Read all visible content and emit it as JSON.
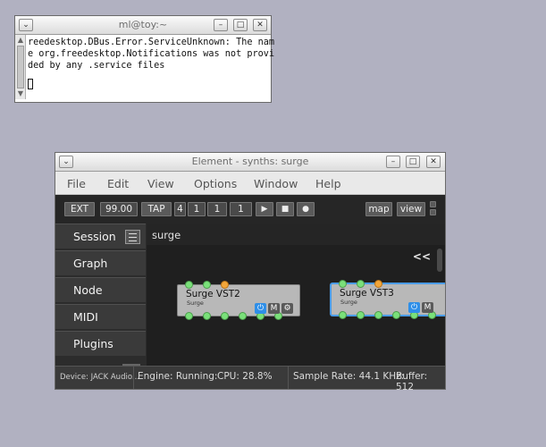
{
  "terminal": {
    "title": "ml@toy:~",
    "lines": [
      "reedesktop.DBus.Error.ServiceUnknown: The nam",
      "e org.freedesktop.Notifications was not provi",
      "ded by any .service files"
    ]
  },
  "element": {
    "title": "Element - synths: surge",
    "menu": [
      "File",
      "Edit",
      "View",
      "Options",
      "Window",
      "Help"
    ],
    "toolbar": {
      "ext": "EXT",
      "tempo": "99.00",
      "tap": "TAP",
      "meter_num": "4",
      "meter_den": "1",
      "pos_a": "1",
      "pos_b": "1",
      "map": "map",
      "view": "view"
    },
    "sidebar": {
      "items": [
        "Session",
        "Graph",
        "Node",
        "MIDI",
        "Plugins"
      ]
    },
    "canvas": {
      "title": "surge",
      "collapse": "<<",
      "nodes": [
        {
          "title": "Surge VST2",
          "subtitle": "Surge",
          "mute": "M"
        },
        {
          "title": "Surge VST3",
          "subtitle": "Surge",
          "mute": "M"
        }
      ]
    },
    "status": {
      "device": "Device: JACK Audio...",
      "engine": "Engine: Running:",
      "cpu": "CPU: 28.8%",
      "sample_rate": "Sample Rate: 44.1 KHz:",
      "buffer": "Buffer: 512"
    }
  },
  "colors": {
    "desktop": "#b1b1c1",
    "node_power": "#2f8fe8",
    "port_audio": "#7ae07a",
    "port_midi": "#f2a63a",
    "selection": "#4a9be6"
  }
}
